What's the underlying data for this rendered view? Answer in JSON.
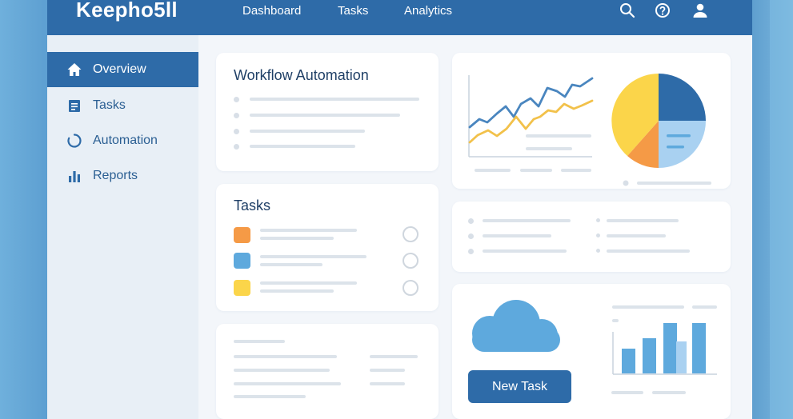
{
  "app": {
    "brand": "Keepho5ll"
  },
  "topnav": {
    "items": [
      "Dashboard",
      "Tasks",
      "Analytics"
    ]
  },
  "sidebar": {
    "items": [
      {
        "label": "Overview",
        "icon": "home-icon",
        "active": true
      },
      {
        "label": "Tasks",
        "icon": "list-icon",
        "active": false
      },
      {
        "label": "Automation",
        "icon": "refresh-icon",
        "active": false
      },
      {
        "label": "Reports",
        "icon": "bar-chart-icon",
        "active": false
      }
    ]
  },
  "cards": {
    "workflow": {
      "title": "Workflow Automation"
    },
    "tasks": {
      "title": "Tasks",
      "items": [
        {
          "color": "#f59a46",
          "done": false
        },
        {
          "color": "#5ea9dd",
          "done": false
        },
        {
          "color": "#fbd54a",
          "done": false
        }
      ]
    },
    "action": {
      "button_label": "New Task"
    }
  },
  "colors": {
    "primary": "#2e6ba8",
    "orange": "#f59a46",
    "blue": "#5ea9dd",
    "yellow": "#fbd54a",
    "light_blue": "#a9d1f1",
    "dark_blue": "#2e6ba8"
  },
  "icons": {
    "search": "search-icon",
    "help": "help-icon",
    "user": "user-icon",
    "cloud": "cloud-icon"
  }
}
